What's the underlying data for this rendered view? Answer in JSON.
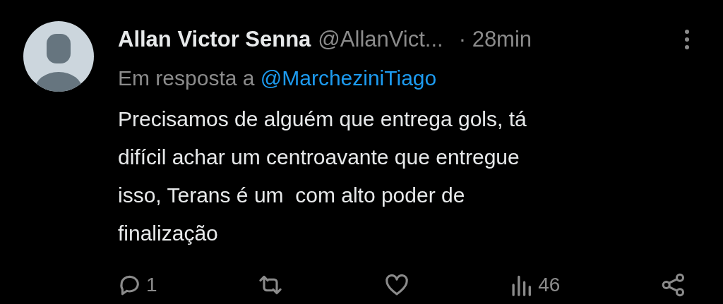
{
  "tweet": {
    "author": {
      "name": "Allan Victor Senna",
      "handle": "@AllanVict...",
      "time": "· 28min"
    },
    "reply_to": {
      "prefix": "Em resposta a",
      "mention": "@MarcheziniTiago"
    },
    "text": "Precisamos de alguém que entrega gols, tá difícil achar um centroavante que entregue isso, Terans é um  com alto poder de finalização",
    "actions": [
      {
        "kind": "reply",
        "count": "1"
      },
      {
        "kind": "retweet"
      },
      {
        "kind": "like"
      },
      {
        "kind": "views",
        "count": "46"
      },
      {
        "kind": "share"
      }
    ]
  }
}
